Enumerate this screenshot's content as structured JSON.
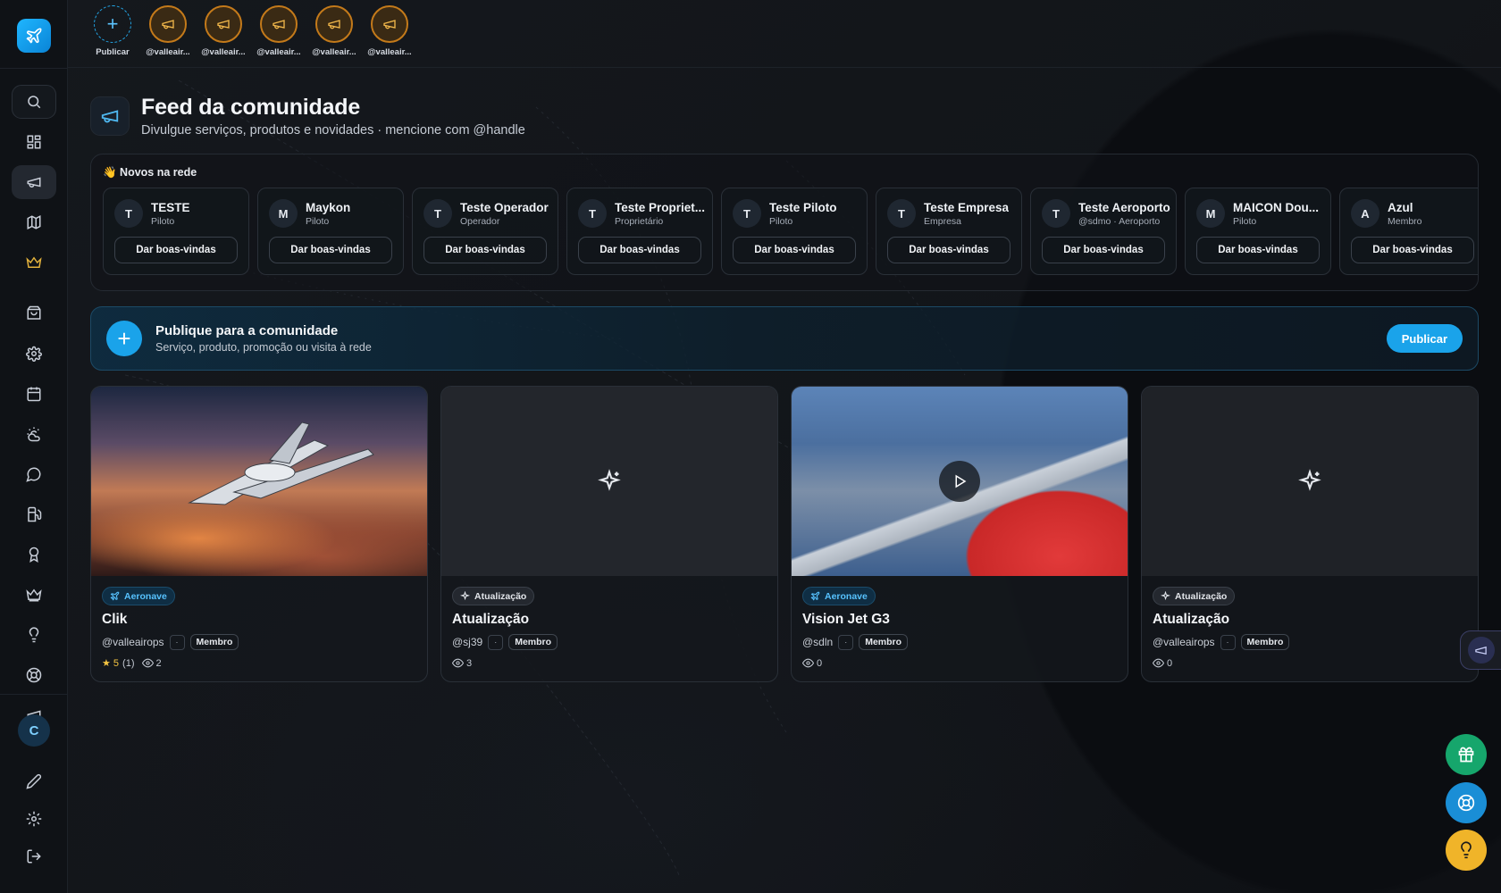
{
  "stories": {
    "add_label": "Publicar",
    "items": [
      {
        "label": "@valleair..."
      },
      {
        "label": "@valleair..."
      },
      {
        "label": "@valleair..."
      },
      {
        "label": "@valleair..."
      },
      {
        "label": "@valleair..."
      }
    ]
  },
  "header": {
    "title": "Feed da comunidade",
    "subtitle": "Divulgue serviços, produtos e novidades · mencione com @handle"
  },
  "novos": {
    "title": "👋 Novos na rede",
    "button_label": "Dar boas-vindas",
    "members": [
      {
        "initial": "T",
        "name": "TESTE",
        "role": "Piloto"
      },
      {
        "initial": "M",
        "name": "Maykon",
        "role": "Piloto"
      },
      {
        "initial": "T",
        "name": "Teste Operador",
        "role": "Operador"
      },
      {
        "initial": "T",
        "name": "Teste Propriet...",
        "role": "Proprietário"
      },
      {
        "initial": "T",
        "name": "Teste Piloto",
        "role": "Piloto"
      },
      {
        "initial": "T",
        "name": "Teste Empresa",
        "role": "Empresa"
      },
      {
        "initial": "T",
        "name": "Teste Aeroporto",
        "role": "@sdmo · Aeroporto"
      },
      {
        "initial": "M",
        "name": "MAICON Dou...",
        "role": "Piloto"
      },
      {
        "initial": "A",
        "name": "Azul",
        "role": "Membro"
      }
    ]
  },
  "publish": {
    "title": "Publique para a comunidade",
    "subtitle": "Serviço, produto, promoção ou visita à rede",
    "button": "Publicar"
  },
  "posts": [
    {
      "tag": "Aeronave",
      "title": "Clik",
      "handle": "@valleairops",
      "dot": "·",
      "badge": "Membro",
      "rating": "★ 5",
      "rating_count": "(1)",
      "views": "2"
    },
    {
      "tag": "Atualização",
      "title": "Atualização",
      "handle": "@sj39",
      "dot": "·",
      "badge": "Membro",
      "views": "3"
    },
    {
      "tag": "Aeronave",
      "title": "Vision Jet G3",
      "handle": "@sdln",
      "dot": "·",
      "badge": "Membro",
      "views": "0"
    },
    {
      "tag": "Atualização",
      "title": "Atualização",
      "handle": "@valleairops",
      "dot": "·",
      "badge": "Membro",
      "views": "0"
    }
  ],
  "sidebar": {
    "avatar_initial": "C"
  },
  "colors": {
    "accent": "#1aa3ea",
    "crown": "#e3b23c",
    "gift": "#16a66c",
    "help": "#1a8ed6",
    "bulb": "#f0b429"
  }
}
